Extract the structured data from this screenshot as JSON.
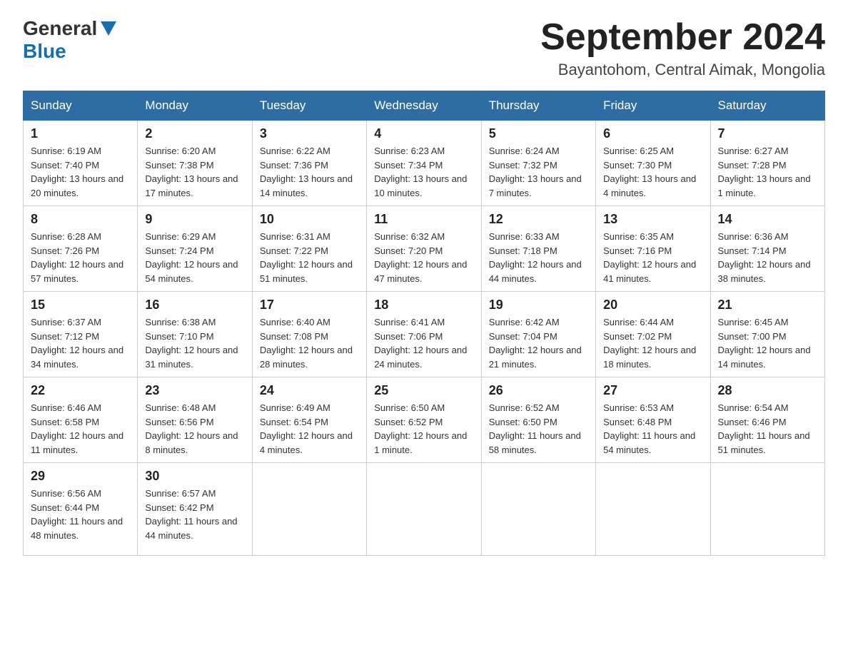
{
  "header": {
    "title": "September 2024",
    "location": "Bayantohom, Central Aimak, Mongolia",
    "logo_general": "General",
    "logo_blue": "Blue"
  },
  "days_of_week": [
    "Sunday",
    "Monday",
    "Tuesday",
    "Wednesday",
    "Thursday",
    "Friday",
    "Saturday"
  ],
  "weeks": [
    [
      {
        "day": "1",
        "sunrise": "Sunrise: 6:19 AM",
        "sunset": "Sunset: 7:40 PM",
        "daylight": "Daylight: 13 hours and 20 minutes."
      },
      {
        "day": "2",
        "sunrise": "Sunrise: 6:20 AM",
        "sunset": "Sunset: 7:38 PM",
        "daylight": "Daylight: 13 hours and 17 minutes."
      },
      {
        "day": "3",
        "sunrise": "Sunrise: 6:22 AM",
        "sunset": "Sunset: 7:36 PM",
        "daylight": "Daylight: 13 hours and 14 minutes."
      },
      {
        "day": "4",
        "sunrise": "Sunrise: 6:23 AM",
        "sunset": "Sunset: 7:34 PM",
        "daylight": "Daylight: 13 hours and 10 minutes."
      },
      {
        "day": "5",
        "sunrise": "Sunrise: 6:24 AM",
        "sunset": "Sunset: 7:32 PM",
        "daylight": "Daylight: 13 hours and 7 minutes."
      },
      {
        "day": "6",
        "sunrise": "Sunrise: 6:25 AM",
        "sunset": "Sunset: 7:30 PM",
        "daylight": "Daylight: 13 hours and 4 minutes."
      },
      {
        "day": "7",
        "sunrise": "Sunrise: 6:27 AM",
        "sunset": "Sunset: 7:28 PM",
        "daylight": "Daylight: 13 hours and 1 minute."
      }
    ],
    [
      {
        "day": "8",
        "sunrise": "Sunrise: 6:28 AM",
        "sunset": "Sunset: 7:26 PM",
        "daylight": "Daylight: 12 hours and 57 minutes."
      },
      {
        "day": "9",
        "sunrise": "Sunrise: 6:29 AM",
        "sunset": "Sunset: 7:24 PM",
        "daylight": "Daylight: 12 hours and 54 minutes."
      },
      {
        "day": "10",
        "sunrise": "Sunrise: 6:31 AM",
        "sunset": "Sunset: 7:22 PM",
        "daylight": "Daylight: 12 hours and 51 minutes."
      },
      {
        "day": "11",
        "sunrise": "Sunrise: 6:32 AM",
        "sunset": "Sunset: 7:20 PM",
        "daylight": "Daylight: 12 hours and 47 minutes."
      },
      {
        "day": "12",
        "sunrise": "Sunrise: 6:33 AM",
        "sunset": "Sunset: 7:18 PM",
        "daylight": "Daylight: 12 hours and 44 minutes."
      },
      {
        "day": "13",
        "sunrise": "Sunrise: 6:35 AM",
        "sunset": "Sunset: 7:16 PM",
        "daylight": "Daylight: 12 hours and 41 minutes."
      },
      {
        "day": "14",
        "sunrise": "Sunrise: 6:36 AM",
        "sunset": "Sunset: 7:14 PM",
        "daylight": "Daylight: 12 hours and 38 minutes."
      }
    ],
    [
      {
        "day": "15",
        "sunrise": "Sunrise: 6:37 AM",
        "sunset": "Sunset: 7:12 PM",
        "daylight": "Daylight: 12 hours and 34 minutes."
      },
      {
        "day": "16",
        "sunrise": "Sunrise: 6:38 AM",
        "sunset": "Sunset: 7:10 PM",
        "daylight": "Daylight: 12 hours and 31 minutes."
      },
      {
        "day": "17",
        "sunrise": "Sunrise: 6:40 AM",
        "sunset": "Sunset: 7:08 PM",
        "daylight": "Daylight: 12 hours and 28 minutes."
      },
      {
        "day": "18",
        "sunrise": "Sunrise: 6:41 AM",
        "sunset": "Sunset: 7:06 PM",
        "daylight": "Daylight: 12 hours and 24 minutes."
      },
      {
        "day": "19",
        "sunrise": "Sunrise: 6:42 AM",
        "sunset": "Sunset: 7:04 PM",
        "daylight": "Daylight: 12 hours and 21 minutes."
      },
      {
        "day": "20",
        "sunrise": "Sunrise: 6:44 AM",
        "sunset": "Sunset: 7:02 PM",
        "daylight": "Daylight: 12 hours and 18 minutes."
      },
      {
        "day": "21",
        "sunrise": "Sunrise: 6:45 AM",
        "sunset": "Sunset: 7:00 PM",
        "daylight": "Daylight: 12 hours and 14 minutes."
      }
    ],
    [
      {
        "day": "22",
        "sunrise": "Sunrise: 6:46 AM",
        "sunset": "Sunset: 6:58 PM",
        "daylight": "Daylight: 12 hours and 11 minutes."
      },
      {
        "day": "23",
        "sunrise": "Sunrise: 6:48 AM",
        "sunset": "Sunset: 6:56 PM",
        "daylight": "Daylight: 12 hours and 8 minutes."
      },
      {
        "day": "24",
        "sunrise": "Sunrise: 6:49 AM",
        "sunset": "Sunset: 6:54 PM",
        "daylight": "Daylight: 12 hours and 4 minutes."
      },
      {
        "day": "25",
        "sunrise": "Sunrise: 6:50 AM",
        "sunset": "Sunset: 6:52 PM",
        "daylight": "Daylight: 12 hours and 1 minute."
      },
      {
        "day": "26",
        "sunrise": "Sunrise: 6:52 AM",
        "sunset": "Sunset: 6:50 PM",
        "daylight": "Daylight: 11 hours and 58 minutes."
      },
      {
        "day": "27",
        "sunrise": "Sunrise: 6:53 AM",
        "sunset": "Sunset: 6:48 PM",
        "daylight": "Daylight: 11 hours and 54 minutes."
      },
      {
        "day": "28",
        "sunrise": "Sunrise: 6:54 AM",
        "sunset": "Sunset: 6:46 PM",
        "daylight": "Daylight: 11 hours and 51 minutes."
      }
    ],
    [
      {
        "day": "29",
        "sunrise": "Sunrise: 6:56 AM",
        "sunset": "Sunset: 6:44 PM",
        "daylight": "Daylight: 11 hours and 48 minutes."
      },
      {
        "day": "30",
        "sunrise": "Sunrise: 6:57 AM",
        "sunset": "Sunset: 6:42 PM",
        "daylight": "Daylight: 11 hours and 44 minutes."
      },
      null,
      null,
      null,
      null,
      null
    ]
  ]
}
